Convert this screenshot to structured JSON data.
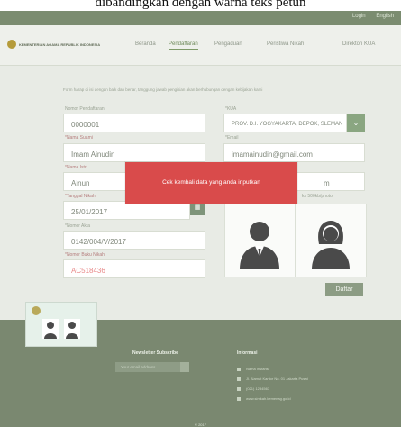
{
  "caption": "dibandingkan dengan warna teks petun",
  "topbar": {
    "login": "Login",
    "language": "English"
  },
  "brand": {
    "name": "KEMENTERIAN AGAMA REPUBLIK INDONESIA"
  },
  "nav": {
    "items": [
      {
        "label": "Beranda"
      },
      {
        "label": "Pendaftaran"
      },
      {
        "label": "Pengaduan"
      },
      {
        "label": "Peristiwa Nikah"
      },
      {
        "label": "Direktori KUA"
      }
    ]
  },
  "form": {
    "intro": "Form harap di isi dengan baik dan benar, tanggung jawab pengisian akan berhubungan dengan kebijakan kami",
    "nomor_pendaftaran": {
      "label": "Nomor Pendaftaran",
      "value": "0000001"
    },
    "kua": {
      "label": "*KUA",
      "value": "PROV. D.I. YOGYAKARTA, DEPOK, SLEMAN"
    },
    "nama_suami": {
      "label": "*Nama Suami",
      "value": "Imam Ainudin"
    },
    "email": {
      "label": "*Email",
      "value": "imamainudin@gmail.com"
    },
    "nama_istri": {
      "label": "*Nama Istri",
      "value": "Ainun"
    },
    "right_field": {
      "value": "m"
    },
    "tanggal_nikah": {
      "label": "*Tanggal Nikah",
      "value": "25/01/2017"
    },
    "foto_note": "ks 500kb/photo",
    "nomor_akta": {
      "label": "*Nomor Akta",
      "value": "0142/004/V/2017"
    },
    "nomor_buku": {
      "label": "*Nomor Buku Nikah",
      "value": "AC518436"
    },
    "submit": "Daftar"
  },
  "alert": {
    "message": "Cek kembali data yang anda inputkan"
  },
  "footer": {
    "newsletter_title": "Newsletter Subscribe",
    "newsletter_placeholder": "Your email address",
    "info_title": "Informasi",
    "info_lines": [
      "Nama Instansi",
      "Jl. Alamat Kantor No. 01 Jakarta Pusat",
      "(021) 1234567",
      "www.simkah.kemenag.go.id"
    ],
    "copyright": "© 2017"
  },
  "colors": {
    "alert": "#d94b4b",
    "accent": "#8aa681",
    "footer": "#7a8870"
  }
}
